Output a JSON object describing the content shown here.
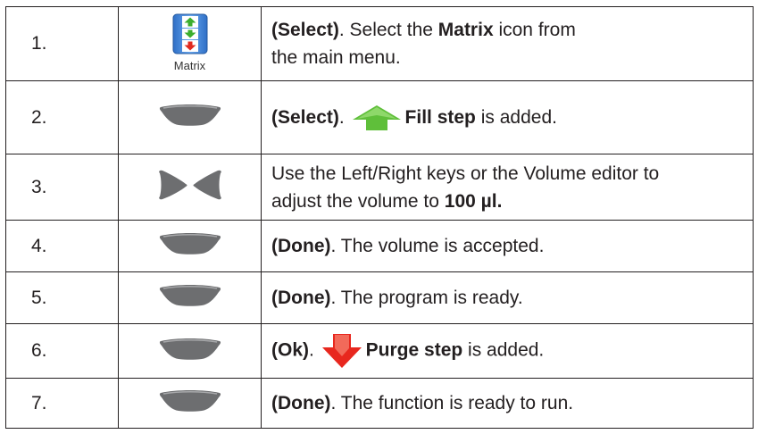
{
  "rows": [
    {
      "num": "1.",
      "icon": "matrix-app-icon",
      "icon_caption": "Matrix",
      "b1": "(Select)",
      "t1": ". Select the ",
      "b2": "Matrix",
      "t2": " icon from",
      "line2": "the main menu."
    },
    {
      "num": "2.",
      "icon": "softkey-button-icon",
      "b1": "(Select)",
      "t1": ". ",
      "arrow": "green-up-arrow-icon",
      "b2": "Fill step",
      "t2": " is added."
    },
    {
      "num": "3.",
      "icon": "left-right-keys-icon",
      "line1": "Use the Left/Right keys or the Volume editor to",
      "t1": "adjust the volume to ",
      "b1": "100 µl."
    },
    {
      "num": "4.",
      "icon": "softkey-button-icon",
      "b1": "(Done)",
      "t1": ". The volume is accepted."
    },
    {
      "num": "5.",
      "icon": "softkey-button-icon",
      "b1": "(Done)",
      "t1": ". The program is ready."
    },
    {
      "num": "6.",
      "icon": "softkey-button-icon",
      "b1": "(Ok)",
      "t1": ". ",
      "arrow": "red-down-arrow-icon",
      "b2": "Purge step",
      "t2": " is added."
    },
    {
      "num": "7.",
      "icon": "softkey-button-icon",
      "b1": "(Done)",
      "t1": ". The function is ready to run."
    }
  ],
  "colors": {
    "border": "#231f20",
    "button_grey": "#6d6e70",
    "fill_arrow_green": "#5fbf3a",
    "purge_arrow_red": "#e8271e",
    "matrix_blue": "#3a7fd5"
  }
}
